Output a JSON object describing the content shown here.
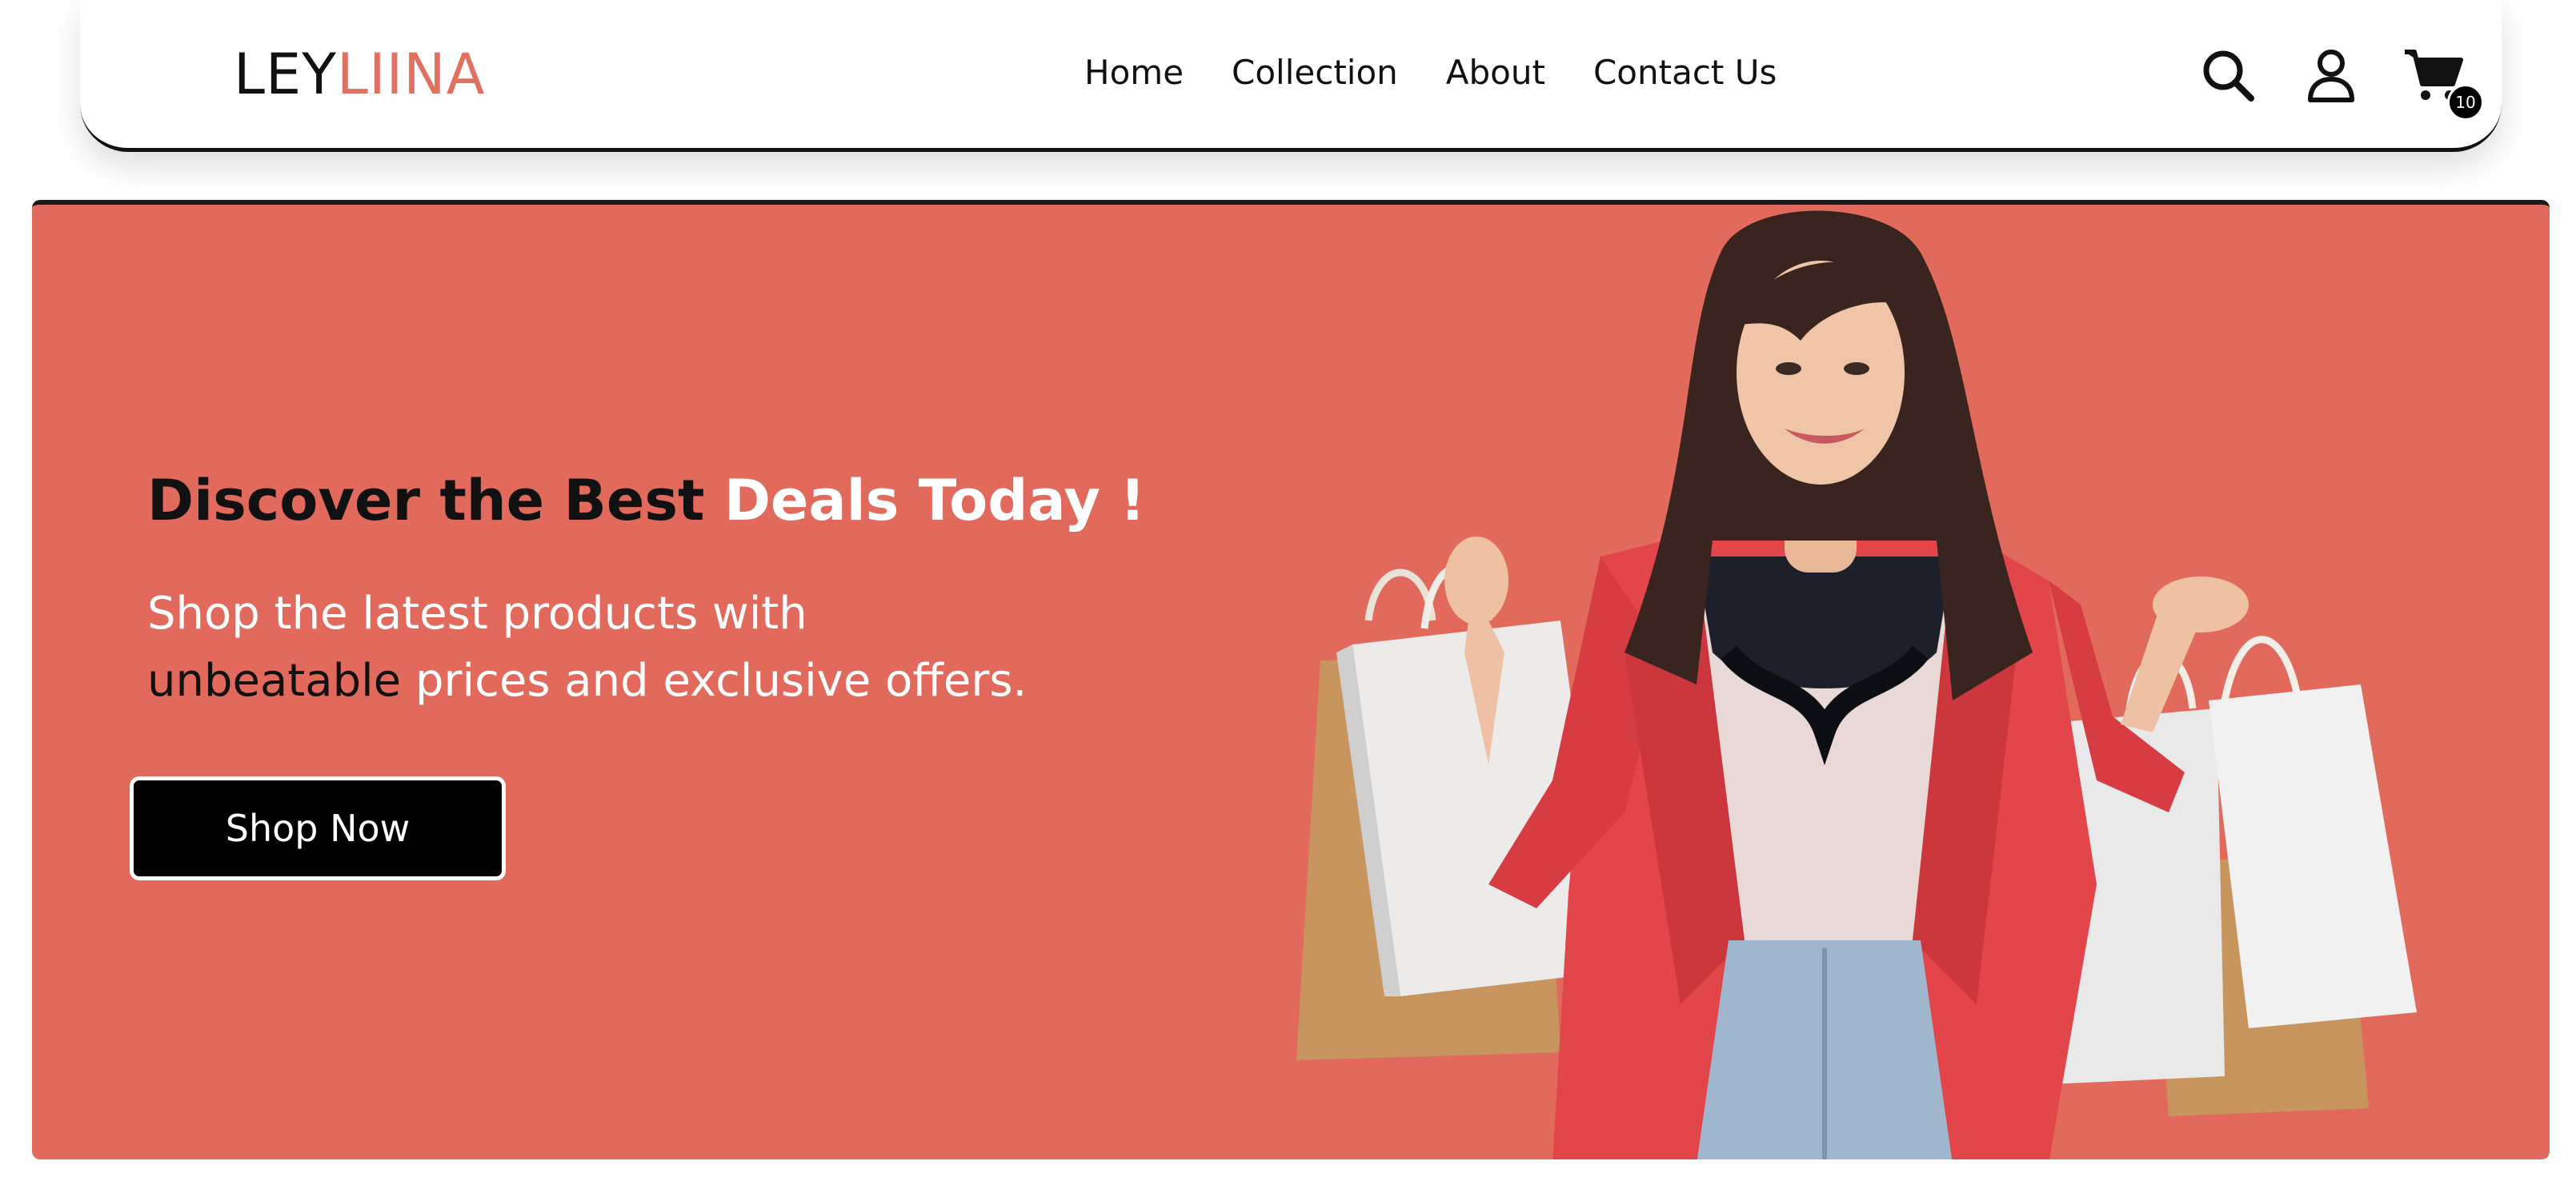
{
  "brand": {
    "part1": "LEY",
    "part2": "LIINA",
    "accent_color": "#e0705f"
  },
  "nav": {
    "links": [
      {
        "label": "Home"
      },
      {
        "label": "Collection"
      },
      {
        "label": "About"
      },
      {
        "label": "Contact Us"
      }
    ]
  },
  "header_icons": {
    "search": "search-icon",
    "account": "user-icon",
    "cart": "cart-icon",
    "cart_count": "10"
  },
  "hero": {
    "title_dark": "Discover the Best ",
    "title_light": "Deals Today !",
    "subtitle": [
      {
        "text": "Shop the latest products with",
        "tone": "light"
      },
      {
        "text": "unbeatable",
        "tone": "dark"
      },
      {
        "text": " prices and exclusive offers.",
        "tone": "light"
      }
    ],
    "cta_label": "Shop Now",
    "background_color": "#e16a5c",
    "image": "woman-with-shopping-bags"
  }
}
